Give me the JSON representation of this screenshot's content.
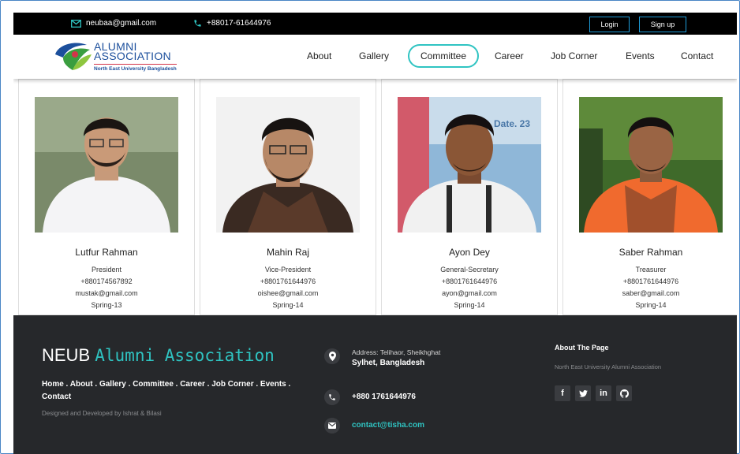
{
  "topbar": {
    "email": "neubaa@gmail.com",
    "phone": "+88017-61644976",
    "login_label": "Login",
    "signup_label": "Sign up"
  },
  "logo": {
    "line1": "ALUMNI",
    "line2": "ASSOCIATION",
    "line3": "North East University Bangladesh"
  },
  "nav": {
    "items": [
      "About",
      "Gallery",
      "Committee",
      "Career",
      "Job Corner",
      "Events",
      "Contact"
    ],
    "active": "Committee"
  },
  "members": [
    {
      "name": "Lutfur Rahman",
      "role": "President",
      "phone": "+880174567892",
      "email": "mustak@gmail.com",
      "batch": "Spring-13"
    },
    {
      "name": "Mahin Raj",
      "role": "Vice-President",
      "phone": "+8801761644976",
      "email": "oishee@gmail.com",
      "batch": "Spring-14"
    },
    {
      "name": "Ayon Dey",
      "role": "General-Secretary",
      "phone": "+8801761644976",
      "email": "ayon@gmail.com",
      "batch": "Spring-14"
    },
    {
      "name": "Saber Rahman",
      "role": "Treasurer",
      "phone": "+8801761644976",
      "email": "saber@gmail.com",
      "batch": "Spring-14"
    }
  ],
  "photo_banner_text": "Date. 23",
  "footer": {
    "title_plain": "NEUB",
    "title_accent": "Alumni Association",
    "links": "Home . About . Gallery . Committee . Career . Job Corner . Events . Contact",
    "credit": "Designed and Developed by Ishrat & Bilasi",
    "address_line1": "Address: Telihaor, Sheikhghat",
    "address_line2": "Sylhet, Bangladesh",
    "phone": "+880 1761644976",
    "email": "contact@tisha.com",
    "about_heading": "About The Page",
    "about_text": "North East University Alumni Association",
    "social": [
      {
        "icon": "facebook-icon",
        "glyph": "f"
      },
      {
        "icon": "twitter-icon",
        "glyph": "🐦"
      },
      {
        "icon": "linkedin-icon",
        "glyph": "in"
      },
      {
        "icon": "github-icon",
        "glyph": "⌾"
      }
    ]
  },
  "colors": {
    "accent": "#2fc4c2",
    "topbar_bg": "#000000",
    "footer_bg": "#26282b",
    "brand_blue": "#1c4f9c"
  }
}
